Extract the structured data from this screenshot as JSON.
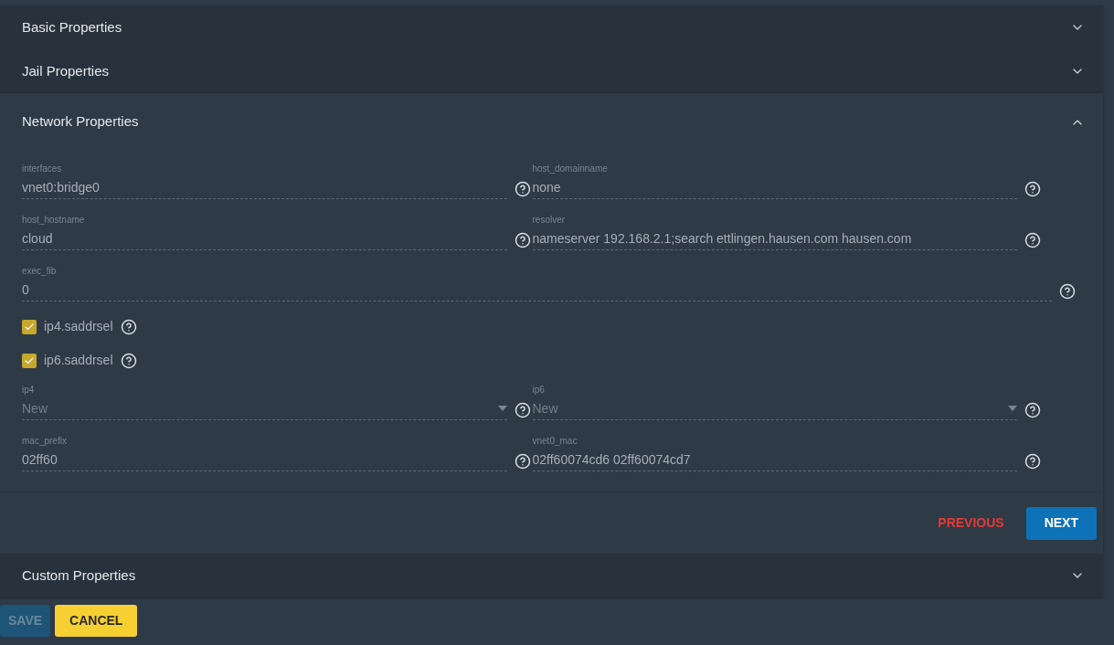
{
  "sections": [
    {
      "title": "Basic Properties",
      "expanded": false
    },
    {
      "title": "Jail Properties",
      "expanded": false
    },
    {
      "title": "Network Properties",
      "expanded": true,
      "rows": [
        {
          "kind": "pair",
          "fields": [
            {
              "label": "interfaces",
              "value": "vnet0:bridge0",
              "kind": "text"
            },
            {
              "label": "host_domainname",
              "value": "none",
              "kind": "text"
            }
          ]
        },
        {
          "kind": "pair",
          "fields": [
            {
              "label": "host_hostname",
              "value": "cloud",
              "kind": "text"
            },
            {
              "label": "resolver",
              "value": "nameserver 192.168.2.1;search ettlingen.hausen.com hausen.com",
              "kind": "text"
            }
          ]
        },
        {
          "kind": "wide",
          "fields": [
            {
              "label": "exec_fib",
              "value": "0",
              "kind": "text"
            }
          ]
        },
        {
          "kind": "checkbox",
          "label": "ip4.saddrsel",
          "checked": true
        },
        {
          "kind": "checkbox",
          "label": "ip6.saddrsel",
          "checked": true
        },
        {
          "kind": "pair",
          "fields": [
            {
              "label": "ip4",
              "value": "New",
              "kind": "select"
            },
            {
              "label": "ip6",
              "value": "New",
              "kind": "select"
            }
          ]
        },
        {
          "kind": "pair",
          "fields": [
            {
              "label": "mac_prefix",
              "value": "02ff60",
              "kind": "text"
            },
            {
              "label": "vnet0_mac",
              "value": "02ff60074cd6 02ff60074cd7",
              "kind": "text"
            }
          ]
        }
      ],
      "buttons": [
        {
          "label": "PREVIOUS",
          "kind": "flat"
        },
        {
          "label": "NEXT",
          "kind": "primary"
        }
      ]
    },
    {
      "title": "Custom Properties",
      "expanded": false
    }
  ],
  "footer_buttons": [
    {
      "label": "SAVE",
      "kind": "save",
      "disabled": true
    },
    {
      "label": "CANCEL",
      "kind": "cancel",
      "disabled": false
    }
  ]
}
